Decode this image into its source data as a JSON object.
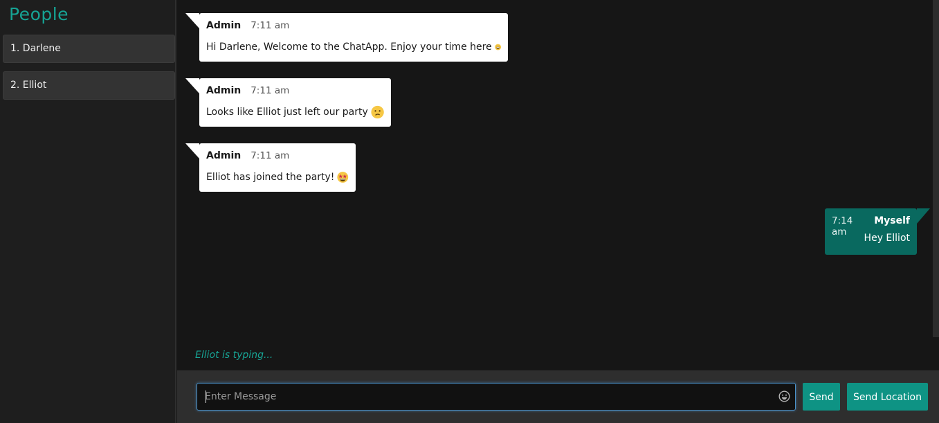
{
  "sidebar": {
    "title": "People",
    "users": [
      {
        "label": "1. Darlene"
      },
      {
        "label": "2. Elliot"
      }
    ]
  },
  "messages": [
    {
      "user": "Admin",
      "time": "7:11 am",
      "text": "Hi Darlene, Welcome to the ChatApp. Enjoy your time here",
      "emoji": "grinning-face-icon",
      "direction": "incoming"
    },
    {
      "user": "Admin",
      "time": "7:11 am",
      "text": "Looks like Elliot just left our party",
      "emoji": "confused-face-icon",
      "direction": "incoming"
    },
    {
      "user": "Admin",
      "time": "7:11 am",
      "text": "Elliot has joined the party!",
      "emoji": "star-struck-face-icon",
      "direction": "incoming"
    },
    {
      "user": "Myself",
      "time": "7:14 am",
      "text": "Hey Elliot",
      "direction": "outgoing"
    }
  ],
  "typing_indicator": "Elliot is typing...",
  "composer": {
    "placeholder": "Enter Message",
    "value": "",
    "emoji_icon": "smiley-picker-icon",
    "send_label": "Send",
    "send_location_label": "Send Location"
  },
  "colors": {
    "accent": "#16a394",
    "outgoing_bubble": "#09695f",
    "incoming_bubble": "#ffffff",
    "button": "#0e9384"
  }
}
